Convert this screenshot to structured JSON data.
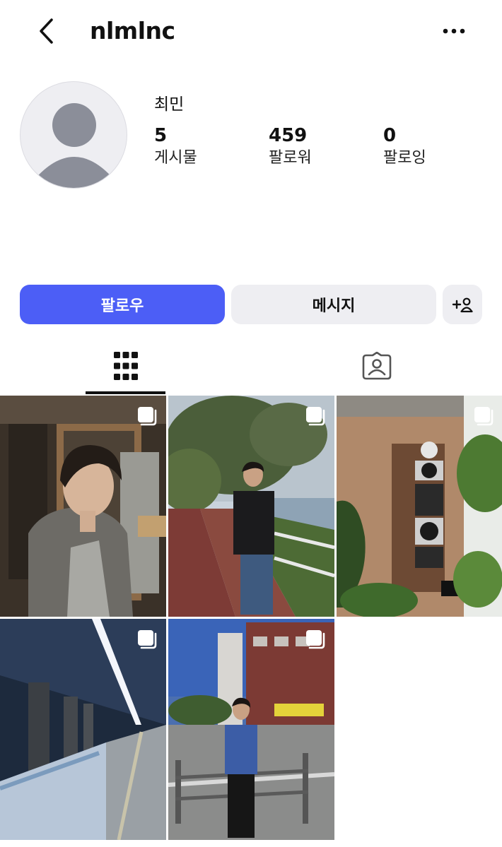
{
  "header": {
    "username": "nlmlnc",
    "back_icon": "chevron-left-icon",
    "more_icon": "more-horizontal-icon"
  },
  "profile": {
    "display_name": "최민",
    "stats": [
      {
        "count": "5",
        "label": "게시물"
      },
      {
        "count": "459",
        "label": "팔로워"
      },
      {
        "count": "0",
        "label": "팔로잉"
      }
    ]
  },
  "actions": {
    "follow_label": "팔로우",
    "message_label": "메시지",
    "add_icon": "add-person-icon"
  },
  "colors": {
    "accent": "#4c5ef6",
    "secondary_button": "#eeeef2"
  },
  "tabs": [
    {
      "icon": "grid-icon",
      "active": true
    },
    {
      "icon": "tagged-person-icon",
      "active": false
    }
  ],
  "posts": [
    {
      "subject": "man in grey blazer indoors",
      "multi": true
    },
    {
      "subject": "man by the river path",
      "multi": true
    },
    {
      "subject": "DJ turntables from above",
      "multi": true
    },
    {
      "subject": "subway platform",
      "multi": true
    },
    {
      "subject": "man on street corner",
      "multi": true
    }
  ]
}
